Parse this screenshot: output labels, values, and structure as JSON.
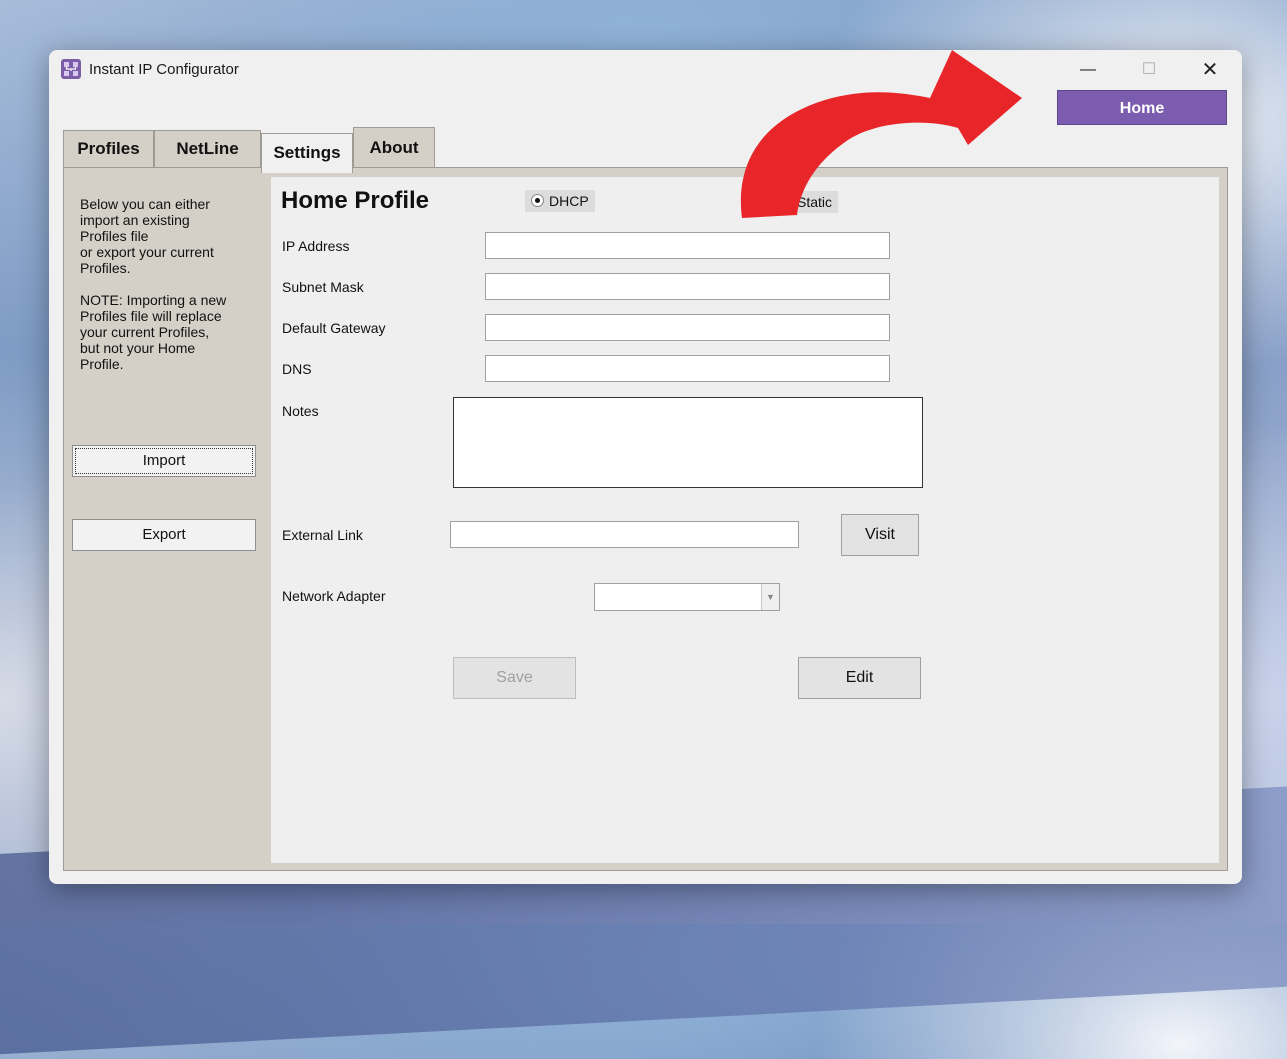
{
  "window": {
    "title": "Instant IP Configurator",
    "controls": {
      "minimize": "—",
      "maximize": "☐",
      "close": "✕"
    }
  },
  "home_button": {
    "label": "Home",
    "color": "#7c5cae"
  },
  "tabs": [
    {
      "label": "Profiles",
      "active": false
    },
    {
      "label": "NetLine",
      "active": false
    },
    {
      "label": "Settings",
      "active": true
    },
    {
      "label": "About",
      "active": false
    }
  ],
  "left_panel": {
    "description": "Below you can either\nimport an existing\nProfiles file\nor export your current\nProfiles.\n\nNOTE: Importing a new\nProfiles file will replace\nyour current Profiles,\nbut not your Home\nProfile.",
    "import_label": "Import",
    "export_label": "Export"
  },
  "profile": {
    "title": "Home Profile",
    "mode_options": [
      {
        "label": "DHCP",
        "selected": true
      },
      {
        "label": "Static",
        "selected": false
      }
    ],
    "fields": {
      "ip_address": {
        "label": "IP Address",
        "value": ""
      },
      "subnet_mask": {
        "label": "Subnet Mask",
        "value": ""
      },
      "default_gateway": {
        "label": "Default Gateway",
        "value": ""
      },
      "dns": {
        "label": "DNS",
        "value": ""
      },
      "notes": {
        "label": "Notes",
        "value": ""
      },
      "external_link": {
        "label": "External Link",
        "value": ""
      },
      "network_adapter": {
        "label": "Network Adapter",
        "value": ""
      }
    },
    "visit_label": "Visit",
    "save_label": "Save",
    "edit_label": "Edit"
  },
  "annotation": {
    "color": "#e8262a"
  }
}
